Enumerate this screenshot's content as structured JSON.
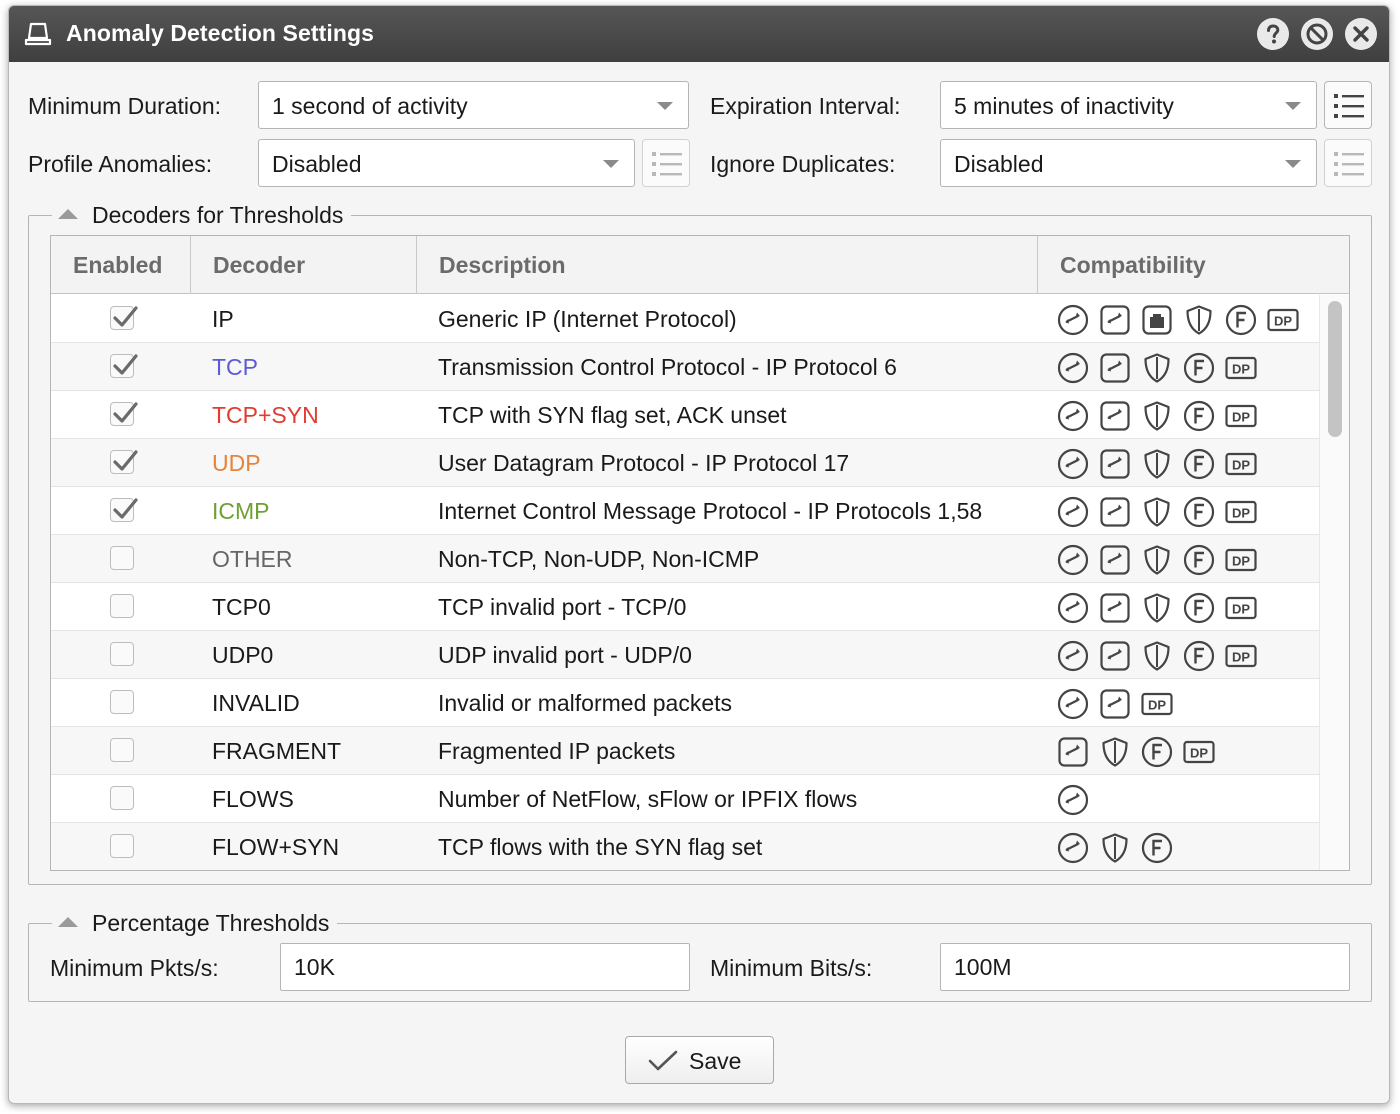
{
  "window": {
    "title": "Anomaly Detection Settings",
    "icon": "monitor-stand-icon",
    "buttons": [
      "help-icon",
      "block-icon",
      "close-icon"
    ]
  },
  "settings": {
    "min_duration_label": "Minimum Duration:",
    "min_duration_value": "1 second of activity",
    "expiration_label": "Expiration Interval:",
    "expiration_value": "5 minutes of inactivity",
    "profile_label": "Profile Anomalies:",
    "profile_value": "Disabled",
    "ignore_label": "Ignore Duplicates:",
    "ignore_value": "Disabled"
  },
  "decoders": {
    "legend": "Decoders for Thresholds",
    "headers": {
      "enabled": "Enabled",
      "decoder": "Decoder",
      "description": "Description",
      "compatibility": "Compatibility"
    },
    "rows": [
      {
        "enabled": true,
        "name": "IP",
        "color": "#1a1a1a",
        "description": "Generic IP (Internet Protocol)",
        "icons": [
          "flow-icon",
          "sflow-icon",
          "packet-icon",
          "shield-icon",
          "f-icon",
          "dp-icon"
        ]
      },
      {
        "enabled": true,
        "name": "TCP",
        "color": "#5b5bd6",
        "description": "Transmission Control Protocol - IP Protocol 6",
        "icons": [
          "flow-icon",
          "sflow-icon",
          "shield-icon",
          "f-icon",
          "dp-icon"
        ]
      },
      {
        "enabled": true,
        "name": "TCP+SYN",
        "color": "#e03c31",
        "description": "TCP with SYN flag set, ACK unset",
        "icons": [
          "flow-icon",
          "sflow-icon",
          "shield-icon",
          "f-icon",
          "dp-icon"
        ]
      },
      {
        "enabled": true,
        "name": "UDP",
        "color": "#e8833a",
        "description": "User Datagram Protocol - IP Protocol 17",
        "icons": [
          "flow-icon",
          "sflow-icon",
          "shield-icon",
          "f-icon",
          "dp-icon"
        ]
      },
      {
        "enabled": true,
        "name": "ICMP",
        "color": "#6fa035",
        "description": "Internet Control Message Protocol - IP Protocols 1,58",
        "icons": [
          "flow-icon",
          "sflow-icon",
          "shield-icon",
          "f-icon",
          "dp-icon"
        ]
      },
      {
        "enabled": false,
        "name": "OTHER",
        "color": "#666666",
        "description": "Non-TCP, Non-UDP, Non-ICMP",
        "icons": [
          "flow-icon",
          "sflow-icon",
          "shield-icon",
          "f-icon",
          "dp-icon"
        ]
      },
      {
        "enabled": false,
        "name": "TCP0",
        "color": "#1a1a1a",
        "description": "TCP invalid port - TCP/0",
        "icons": [
          "flow-icon",
          "sflow-icon",
          "shield-icon",
          "f-icon",
          "dp-icon"
        ]
      },
      {
        "enabled": false,
        "name": "UDP0",
        "color": "#1a1a1a",
        "description": "UDP invalid port - UDP/0",
        "icons": [
          "flow-icon",
          "sflow-icon",
          "shield-icon",
          "f-icon",
          "dp-icon"
        ]
      },
      {
        "enabled": false,
        "name": "INVALID",
        "color": "#1a1a1a",
        "description": "Invalid or malformed packets",
        "icons": [
          "flow-icon",
          "sflow-icon",
          "dp-icon"
        ]
      },
      {
        "enabled": false,
        "name": "FRAGMENT",
        "color": "#1a1a1a",
        "description": "Fragmented IP packets",
        "icons": [
          "sflow-icon",
          "shield-icon",
          "f-icon",
          "dp-icon"
        ]
      },
      {
        "enabled": false,
        "name": "FLOWS",
        "color": "#1a1a1a",
        "description": "Number of NetFlow, sFlow or IPFIX flows",
        "icons": [
          "flow-icon"
        ]
      },
      {
        "enabled": false,
        "name": "FLOW+SYN",
        "color": "#1a1a1a",
        "description": "TCP flows with the SYN flag set",
        "icons": [
          "flow-icon",
          "shield-icon",
          "f-icon"
        ]
      }
    ]
  },
  "percentage": {
    "legend": "Percentage Thresholds",
    "min_pkts_label": "Minimum Pkts/s:",
    "min_pkts_value": "10K",
    "min_bits_label": "Minimum Bits/s:",
    "min_bits_value": "100M"
  },
  "save_label": "Save"
}
